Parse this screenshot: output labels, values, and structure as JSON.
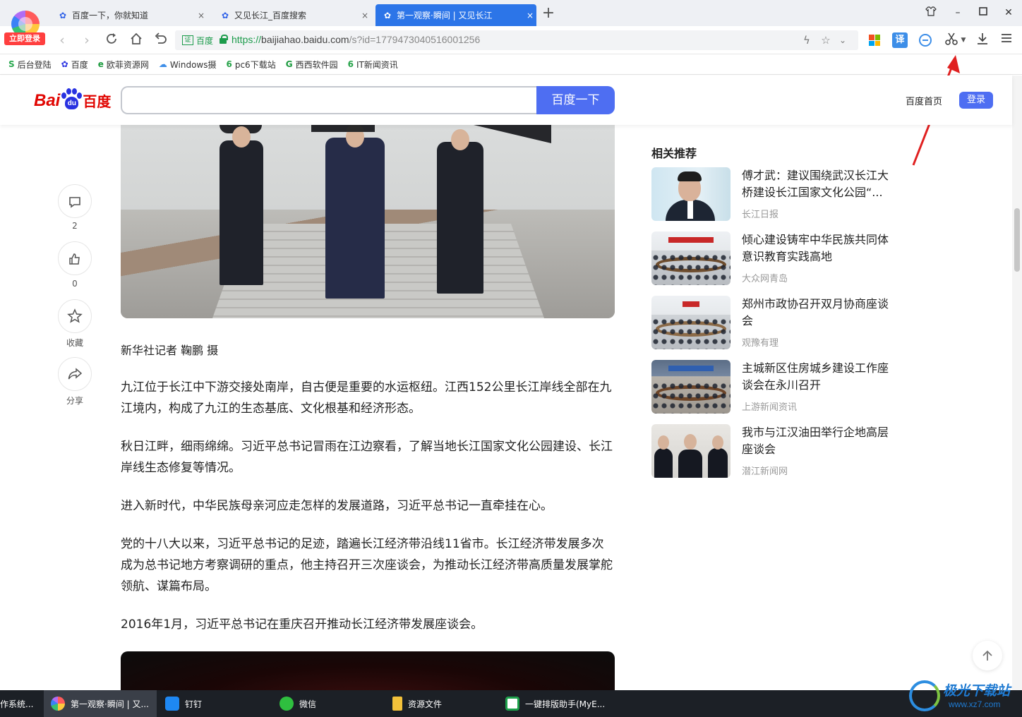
{
  "browser": {
    "login_badge": "立即登录",
    "tabs": [
      {
        "title": "百度一下，你就知道",
        "close": "×"
      },
      {
        "title": "又见长江_百度搜索",
        "close": "×"
      },
      {
        "title": "第一观察·瞬间 | 又见长江",
        "close": "×",
        "active": true
      }
    ],
    "new_tab": "+",
    "address": {
      "cert_label": "百度",
      "url_protocol": "https://",
      "url_host": "baijiahao.baidu.com",
      "url_path": "/s?id=1779473040516001256"
    },
    "icons": [
      "back-icon",
      "forward-icon",
      "reload-icon",
      "home-icon",
      "undo-icon",
      "lightning-icon",
      "star-icon",
      "dropdown-icon",
      "apps-icon",
      "translate-icon",
      "adblock-icon",
      "screenshot-scissors-icon",
      "download-icon",
      "menu-icon"
    ],
    "translate_label": "译",
    "accent": "#2c75e8"
  },
  "bookmarks": [
    {
      "label": "后台登陆",
      "icon": "S"
    },
    {
      "label": "百度",
      "icon": "✿"
    },
    {
      "label": "欧菲资源网",
      "icon": "e"
    },
    {
      "label": "Windows摄",
      "icon": "☁"
    },
    {
      "label": "pc6下载站",
      "icon": "6"
    },
    {
      "label": "西西软件园",
      "icon": "G"
    },
    {
      "label": "IT新闻资讯",
      "icon": "6"
    }
  ],
  "header": {
    "logo_bai": "Bai",
    "logo_paw": "du",
    "logo_du": "百度",
    "search_button": "百度一下",
    "home_link": "百度首页",
    "login": "登录",
    "brand_color": "#4e6ef2"
  },
  "side_actions": {
    "comment_count": "2",
    "like_count": "0",
    "collect_label": "收藏",
    "share_label": "分享"
  },
  "article": {
    "caption": "新华社记者 鞠鹏 摄",
    "paragraphs": [
      "九江位于长江中下游交接处南岸，自古便是重要的水运枢纽。江西152公里长江岸线全部在九江境内，构成了九江的生态基底、文化根基和经济形态。",
      "秋日江畔，细雨绵绵。习近平总书记冒雨在江边察看，了解当地长江国家文化公园建设、长江岸线生态修复等情况。",
      "进入新时代，中华民族母亲河应走怎样的发展道路，习近平总书记一直牵挂在心。",
      "党的十八大以来，习近平总书记的足迹，踏遍长江经济带沿线11省市。长江经济带发展多次成为总书记地方考察调研的重点，他主持召开三次座谈会，为推动长江经济带高质量发展掌舵领航、谋篇布局。",
      "2016年1月，习近平总书记在重庆召开推动长江经济带发展座谈会。"
    ]
  },
  "related": {
    "title": "相关推荐",
    "items": [
      {
        "title": "傅才武：建议围绕武汉长江大桥建设长江国家文化公园“...",
        "source": "长江日报"
      },
      {
        "title": "倾心建设铸牢中华民族共同体意识教育实践高地",
        "source": "大众网青岛"
      },
      {
        "title": "郑州市政协召开双月协商座谈会",
        "source": "观豫有理"
      },
      {
        "title": "主城新区住房城乡建设工作座谈会在永川召开",
        "source": "上游新闻资讯"
      },
      {
        "title": "我市与江汉油田举行企地高层座谈会",
        "source": "潜江新闻网"
      }
    ]
  },
  "taskbar": [
    {
      "label": "作系统..."
    },
    {
      "label": "第一观察·瞬间 | 又...",
      "active": true
    },
    {
      "label": "钉钉"
    },
    {
      "label": "微信"
    },
    {
      "label": "资源文件"
    },
    {
      "label": "一键排版助手(MyE..."
    }
  ],
  "watermark": {
    "name": "极光下载站",
    "url": "www.xz7.com"
  }
}
